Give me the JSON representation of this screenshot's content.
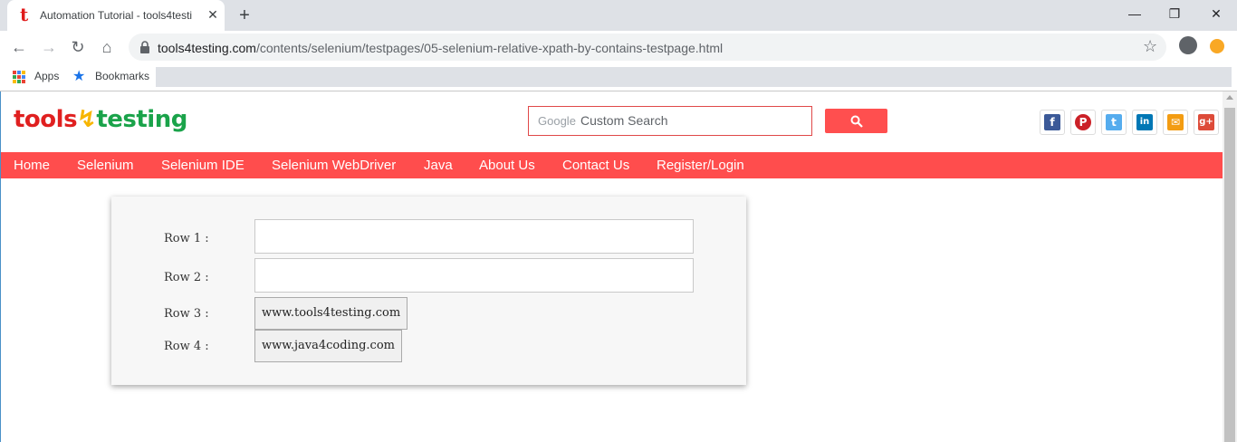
{
  "browser": {
    "tab_title": "Automation Tutorial - tools4testi",
    "tab_favicon": "t",
    "close_tab_glyph": "✕",
    "new_tab_glyph": "+",
    "url_host": "tools4testing.com",
    "url_path": "/contents/selenium/testpages/05-selenium-relative-xpath-by-contains-testpage.html",
    "bookmarks": [
      {
        "label": "Apps",
        "icon": "apps-grid-icon"
      },
      {
        "label": "Bookmarks",
        "icon": "star-icon"
      }
    ]
  },
  "header": {
    "logo_part1": "tools",
    "logo_part2": "testing",
    "search_brand": "Google",
    "search_placeholder": "Custom Search",
    "social": [
      {
        "name": "facebook-icon",
        "glyph": "f",
        "color": "#3b5998"
      },
      {
        "name": "pinterest-icon",
        "glyph": "P",
        "color": "#cb2027"
      },
      {
        "name": "twitter-icon",
        "glyph": "t",
        "color": "#55acee"
      },
      {
        "name": "linkedin-icon",
        "glyph": "in",
        "color": "#0077b5"
      },
      {
        "name": "email-icon",
        "glyph": "✉",
        "color": "#f39c12"
      },
      {
        "name": "googleplus-icon",
        "glyph": "g+",
        "color": "#dd4b39"
      }
    ]
  },
  "nav": {
    "items": [
      "Home",
      "Selenium",
      "Selenium IDE",
      "Selenium WebDriver",
      "Java",
      "About Us",
      "Contact Us",
      "Register/Login"
    ]
  },
  "form": {
    "row1_label": "Row 1 :",
    "row2_label": "Row 2 :",
    "row3_label": "Row 3 :",
    "row4_label": "Row 4 :",
    "row1_value": "",
    "row2_value": "",
    "row3_button": "www.tools4testing.com",
    "row4_button": "www.java4coding.com"
  },
  "colors": {
    "accent": "#ff4d4d",
    "logo_red": "#e02020",
    "logo_green": "#1aa34a"
  }
}
